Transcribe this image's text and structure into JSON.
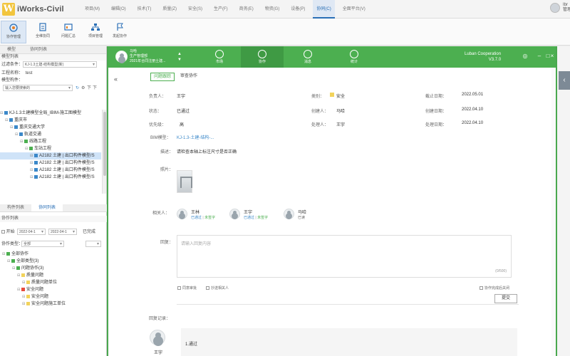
{
  "app": {
    "logo": "W",
    "title": "iWorks-Civil",
    "user": "Ibr\n管理"
  },
  "menu": [
    "项目(M)",
    "编辑(O)",
    "技术(T)",
    "质量(Z)",
    "安全(S)",
    "生产(F)",
    "商务(E)",
    "物资(G)",
    "设备(P)",
    "协同(C)",
    "全面平台(V)"
  ],
  "menu_active_index": 9,
  "ribbon": [
    "协作管理",
    "全维协同",
    "问题汇总",
    "项目管理",
    "发起协作"
  ],
  "left": {
    "tabs": [
      "模型",
      "协同列表"
    ],
    "sub": "模型列表",
    "filter_label": "过滤条件：",
    "filter_value": "KJ-1.3土建-结构模型(新)",
    "project_label": "工程名称：",
    "project_value": "test",
    "model_label": "模型构件：",
    "model_search": "输入您要搜索的",
    "tree": [
      {
        "indent": 0,
        "text": "KJ-1.3土建模型全局_IBIM-施工图模型",
        "color": "#3b88c9"
      },
      {
        "indent": 1,
        "text": "重庆市",
        "color": "#3b88c9"
      },
      {
        "indent": 2,
        "text": "重庆交通大学",
        "color": "#3b88c9"
      },
      {
        "indent": 3,
        "text": "轨道交通",
        "color": "#3b88c9"
      },
      {
        "indent": 4,
        "text": "线路工程",
        "color": "#4caf50"
      },
      {
        "indent": 5,
        "text": "车站工程",
        "color": "#4caf50"
      },
      {
        "indent": 6,
        "text": "A2182 土建 | 出口构件模型/S",
        "color": "#3b88c9",
        "selected": true
      },
      {
        "indent": 6,
        "text": "A2182 土建 | 出口构件模型/S",
        "color": "#3b88c9"
      },
      {
        "indent": 6,
        "text": "A2182 土建 | 出口构件模型/S",
        "color": "#3b88c9"
      },
      {
        "indent": 6,
        "text": "A2182 土建 | 出口构件模型/S",
        "color": "#3b88c9"
      }
    ],
    "tabs2": [
      "构件列表",
      "协同列表"
    ],
    "sub2": "协作列表",
    "date_label": "开始",
    "date_from": "2022-04-1",
    "date_to": "2022-04-1",
    "status_label": "已完成",
    "type_label": "协作类型：",
    "type_value": "全部",
    "tree2": [
      {
        "indent": 0,
        "text": "全部协作",
        "color": "#4caf50"
      },
      {
        "indent": 1,
        "text": "全部类型(3)",
        "color": "#4caf50"
      },
      {
        "indent": 2,
        "text": "问题协作(3)",
        "color": "#4caf50"
      },
      {
        "indent": 3,
        "text": "质量问题",
        "color": "#f2d35b"
      },
      {
        "indent": 4,
        "text": "质量问题单位",
        "color": "#f2d35b"
      },
      {
        "indent": 3,
        "text": "安全问题",
        "color": "#e74c3c"
      },
      {
        "indent": 4,
        "text": "安全问题",
        "color": "#f2d35b"
      },
      {
        "indent": 4,
        "text": "安全问题施工单位",
        "color": "#f2d35b"
      }
    ]
  },
  "dialog": {
    "user": {
      "line1": "马哈",
      "line2": "生产管理部",
      "line3": "2021年合同注册土建..."
    },
    "nav": [
      "市场",
      "协作",
      "消息",
      "统计"
    ],
    "nav_active_index": 1,
    "brand": {
      "name": "Luban Cooperation",
      "version": "V3.7.0"
    },
    "tabs": [
      "问题跟踪",
      "审查协作"
    ],
    "fields": {
      "owner_label": "负责人：",
      "owner": "王宇",
      "type_label": "类别：",
      "type": "安全",
      "deadline_label": "截止日期：",
      "deadline": "2022.05.01",
      "status_label": "状态：",
      "status": "已通过",
      "creator_label": "创建人：",
      "creator": "马哈",
      "create_date_label": "创建日期：",
      "create_date": "2022.04.10",
      "priority_label": "优先级：",
      "priority": "高",
      "handler_label": "处理人：",
      "handler": "王宇",
      "handle_date_label": "处理日期：",
      "handle_date": "2022.04.10",
      "bim_label": "BIM模型：",
      "bim": "KJ-1.3-土建-结构-...",
      "desc_label": "描述：",
      "desc": "请检查本轴上标注尺寸是否正确",
      "photo_label": "照片："
    },
    "people_label": "相关人：",
    "people": [
      {
        "name": "王林",
        "st1": "已通过",
        "st2": "未签字"
      },
      {
        "name": "王宇",
        "st1": "已通过",
        "st2": "未签字"
      },
      {
        "name": "马哈",
        "st1": "已读",
        "st2": ""
      }
    ],
    "reply_label": "回复：",
    "reply_placeholder": "请输入回复内容",
    "reply_count": "(0/500)",
    "opt1": "同意审批",
    "opt2": "抄送相关人",
    "opt3": "协作完成后关闭",
    "submit": "提交",
    "history_label": "回复记录：",
    "history_user": "王宇",
    "history_text": "1.通过"
  }
}
